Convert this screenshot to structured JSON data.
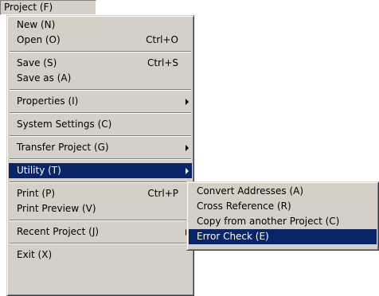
{
  "menubar": {
    "title": "Project (F)"
  },
  "menu": {
    "new": "New (N)",
    "open": "Open (O)",
    "open_shortcut": "Ctrl+O",
    "save": "Save (S)",
    "save_shortcut": "Ctrl+S",
    "save_as": "Save as (A)",
    "properties": "Properties (I)",
    "system_settings": "System Settings (C)",
    "transfer_project": "Transfer Project (G)",
    "utility": "Utility (T)",
    "print": "Print (P)",
    "print_shortcut": "Ctrl+P",
    "print_preview": "Print Preview (V)",
    "recent_project": "Recent Project (J)",
    "exit": "Exit (X)"
  },
  "submenu": {
    "convert_addresses": "Convert Addresses (A)",
    "cross_reference": "Cross Reference (R)",
    "copy_from_project": "Copy from another Project (C)",
    "error_check": "Error Check (E)"
  },
  "colors": {
    "menu_bg": "#d4d0c8",
    "highlight_bg": "#0a246a",
    "highlight_text": "#ffffff"
  },
  "icons": [
    "submenu-arrow-icon"
  ]
}
